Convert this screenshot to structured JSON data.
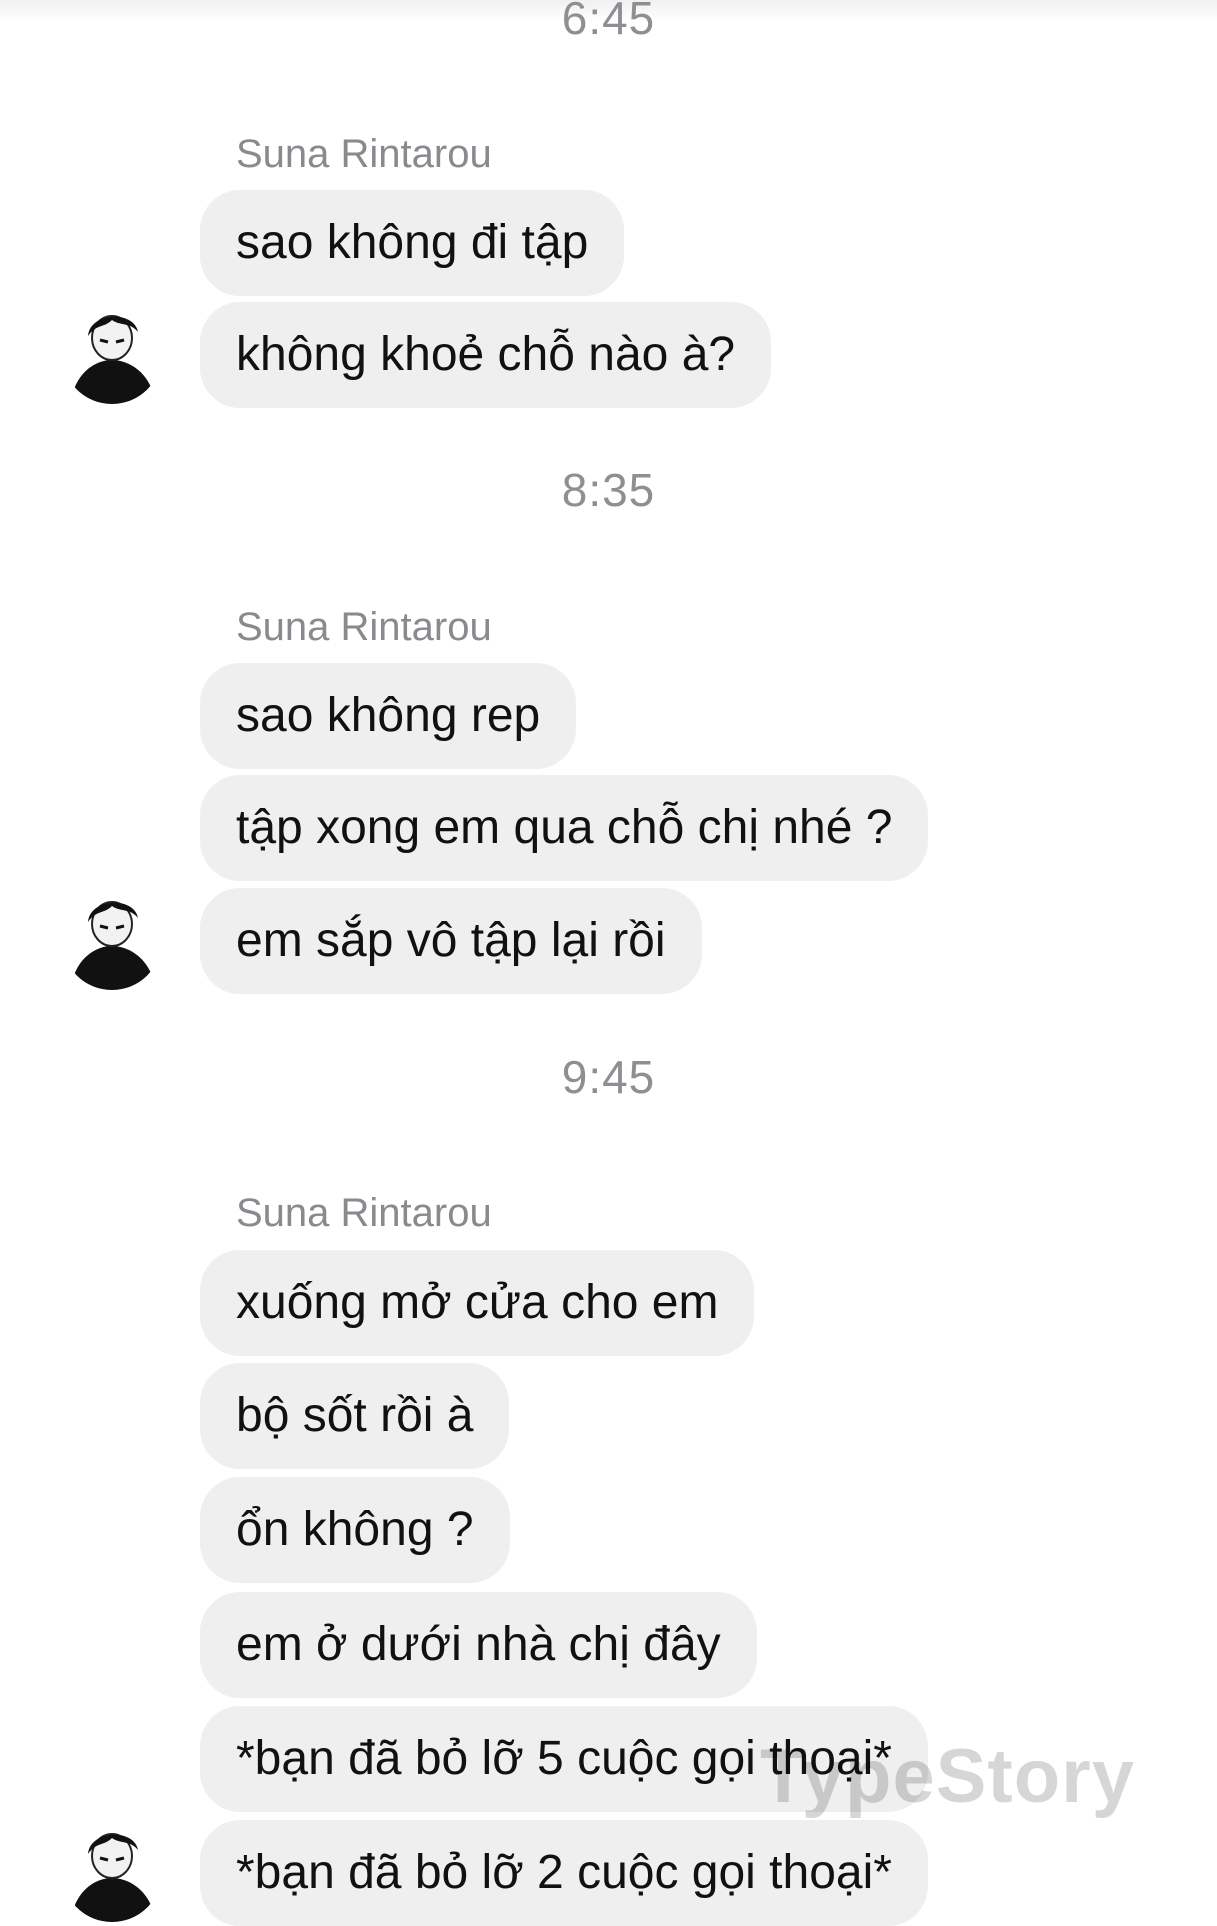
{
  "groups": [
    {
      "time": "6:45",
      "sender": "Suna Rintarou",
      "messages": [
        "sao không đi tập",
        "không khoẻ chỗ nào à?"
      ]
    },
    {
      "time": "8:35",
      "sender": "Suna Rintarou",
      "messages": [
        "sao không rep",
        "tập xong em qua chỗ chị nhé ?",
        "em sắp vô tập lại rồi"
      ]
    },
    {
      "time": "9:45",
      "sender": "Suna Rintarou",
      "messages": [
        "xuống mở cửa cho em",
        "bộ sốt rồi à",
        "ổn không ?",
        "em ở dưới nhà chị đây",
        "*bạn đã bỏ lỡ 5 cuộc gọi thoại*",
        "*bạn đã bỏ lỡ 2 cuộc gọi thoại*"
      ]
    }
  ],
  "watermark": "TypeStory",
  "colors": {
    "bubble": "#efefef",
    "text": "#111111",
    "meta": "#8e8e93"
  },
  "icons": {
    "avatar": "profile-avatar-icon"
  }
}
